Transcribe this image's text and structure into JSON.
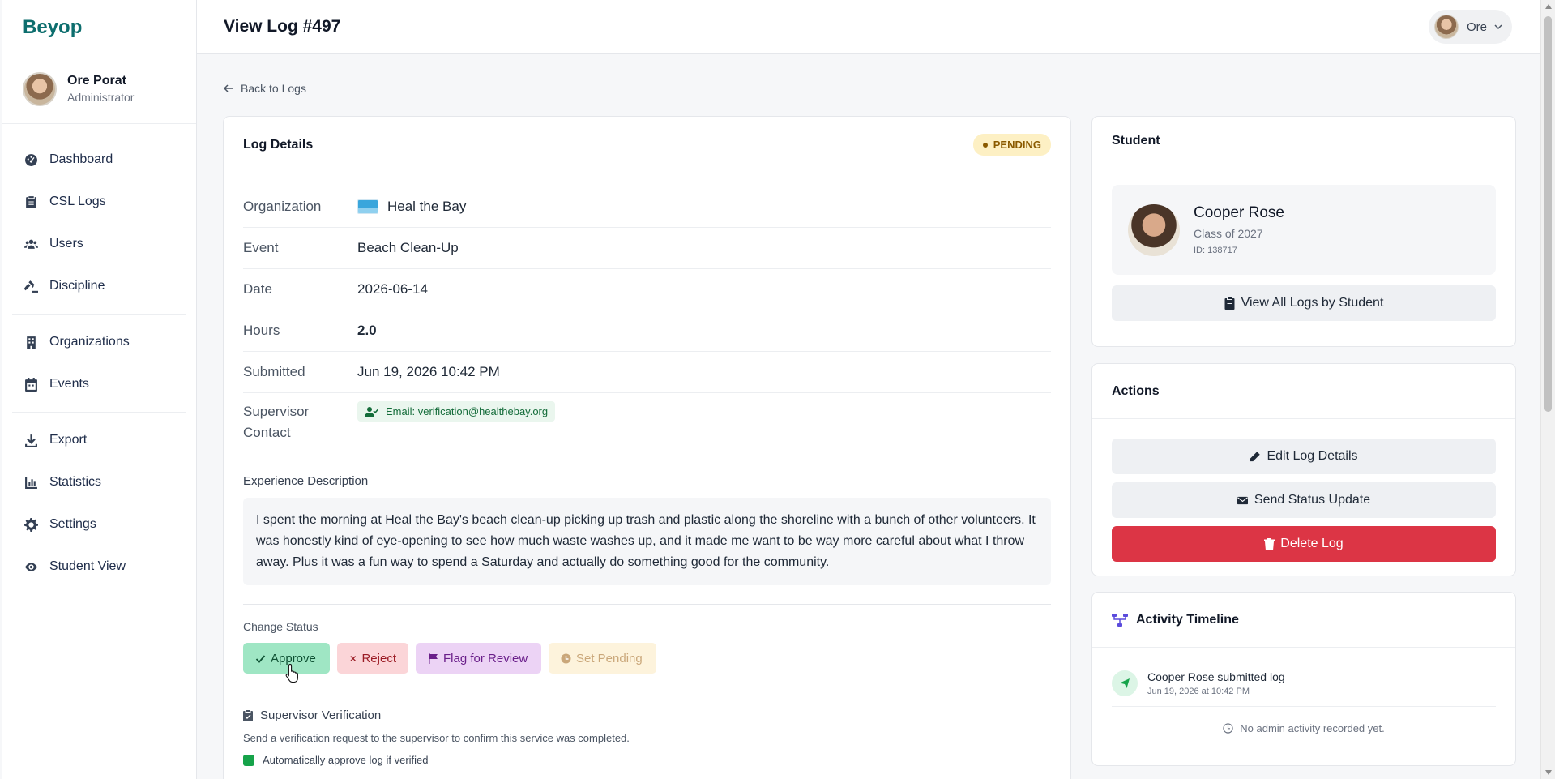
{
  "brand": "Beyop",
  "profile": {
    "name": "Ore Porat",
    "role": "Administrator"
  },
  "nav": [
    [
      {
        "label": "Dashboard",
        "icon": "dashboard-icon"
      },
      {
        "label": "CSL Logs",
        "icon": "clipboard-icon"
      },
      {
        "label": "Users",
        "icon": "users-icon"
      },
      {
        "label": "Discipline",
        "icon": "gavel-icon"
      }
    ],
    [
      {
        "label": "Organizations",
        "icon": "building-icon"
      },
      {
        "label": "Events",
        "icon": "calendar-icon"
      }
    ],
    [
      {
        "label": "Export",
        "icon": "download-icon"
      },
      {
        "label": "Statistics",
        "icon": "chart-icon"
      },
      {
        "label": "Settings",
        "icon": "gear-icon"
      },
      {
        "label": "Student View",
        "icon": "eye-icon"
      }
    ]
  ],
  "header": {
    "title": "View Log #497",
    "user_name": "Ore"
  },
  "back_link": "Back to Logs",
  "log": {
    "title": "Log Details",
    "status": "PENDING",
    "labels": {
      "organization": "Organization",
      "event": "Event",
      "date": "Date",
      "hours": "Hours",
      "submitted": "Submitted",
      "supervisor_1": "Supervisor",
      "supervisor_2": "Contact"
    },
    "organization": "Heal the Bay",
    "event": "Beach Clean-Up",
    "date": "2026-06-14",
    "hours": "2.0",
    "submitted": "Jun 19, 2026 10:42 PM",
    "supervisor_contact": "Email: verification@healthebay.org",
    "experience_label": "Experience Description",
    "experience": "I spent the morning at Heal the Bay's beach clean-up picking up trash and plastic along the shoreline with a bunch of other volunteers. It was honestly kind of eye-opening to see how much waste washes up, and it made me want to be way more careful about what I throw away. Plus it was a fun way to spend a Saturday and actually do something good for the community.",
    "change_status_label": "Change Status",
    "buttons": {
      "approve": "Approve",
      "reject": "Reject",
      "flag": "Flag for Review",
      "pending": "Set Pending"
    },
    "verification_title": "Supervisor Verification",
    "verification_desc": "Send a verification request to the supervisor to confirm this service was completed.",
    "auto_approve": "Automatically approve log if verified"
  },
  "student": {
    "title": "Student",
    "name": "Cooper Rose",
    "class": "Class of 2027",
    "id": "ID: 138717",
    "view_all": "View All Logs by Student"
  },
  "actions": {
    "title": "Actions",
    "edit": "Edit Log Details",
    "send": "Send Status Update",
    "delete": "Delete Log"
  },
  "timeline": {
    "title": "Activity Timeline",
    "item_title": "Cooper Rose submitted log",
    "item_time": "Jun 19, 2026 at 10:42 PM",
    "empty": "No admin activity recorded yet."
  },
  "colors": {
    "brand": "#0d6e6e",
    "danger": "#dc3545",
    "pending_bg": "#fdf0c4"
  }
}
